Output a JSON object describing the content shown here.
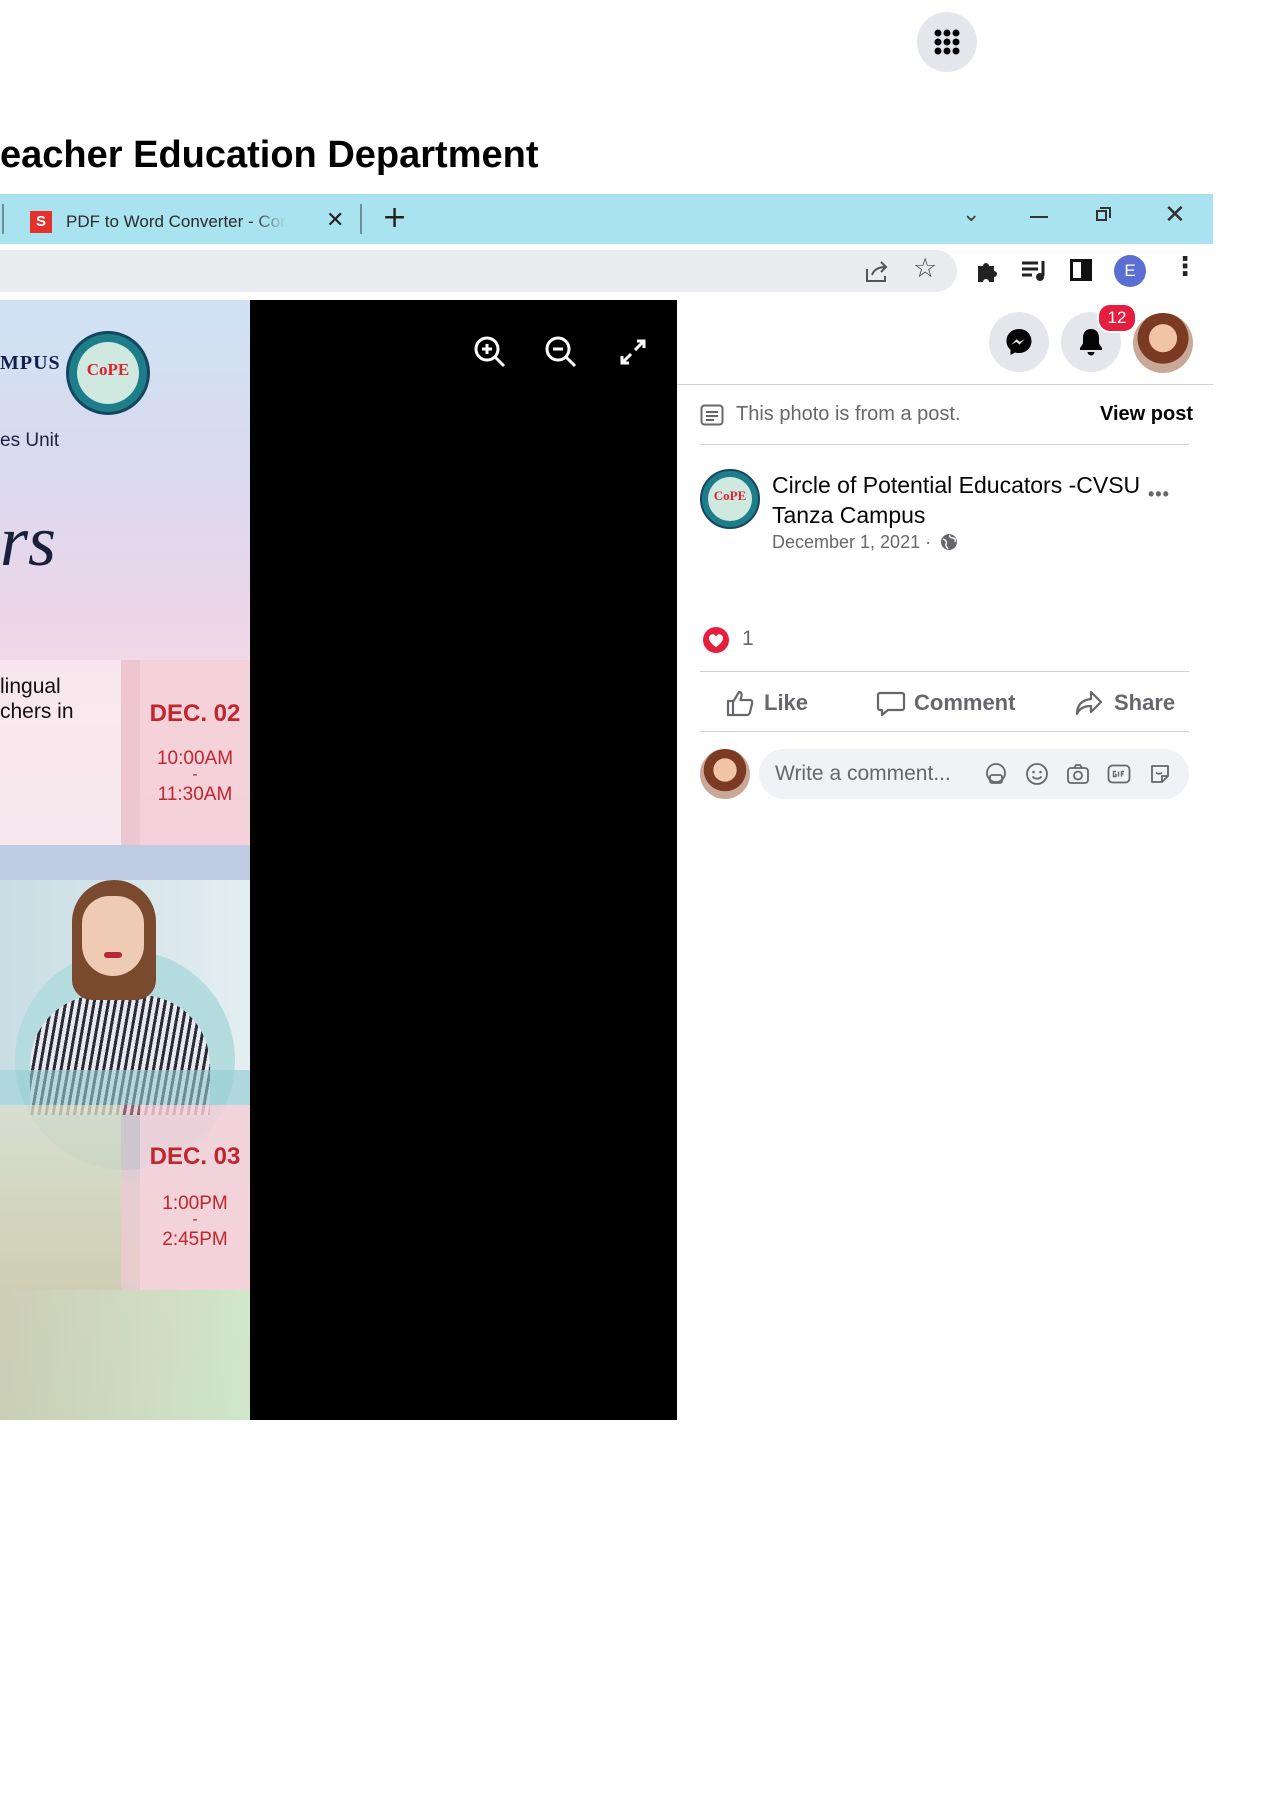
{
  "doc": {
    "heading": "eacher Education Department"
  },
  "browser": {
    "tab_title": "PDF to Word Converter - Convert",
    "tab_favicon_letter": "S",
    "profile_letter": "E"
  },
  "poster": {
    "campus_fragment": "MPUS",
    "unit_fragment": "es Unit",
    "script_fragment": "rs",
    "session1": {
      "text1": "lingual",
      "text2": "chers in",
      "date": "DEC. 02",
      "start": "10:00AM",
      "dash": "-",
      "end": "11:30AM"
    },
    "session2": {
      "date": "DEC. 03",
      "start": "1:00PM",
      "dash": "-",
      "end": "2:45PM"
    },
    "logo_text": "CoPE"
  },
  "facebook": {
    "notification_count": "12",
    "photo_note": "This photo is from a post.",
    "view_post": "View post",
    "page_name": "Circle of Potential Educators -CVSU Tanza Campus",
    "post_date": "December 1, 2021 ·",
    "more": "•••",
    "reaction_count": "1",
    "like": "Like",
    "comment": "Comment",
    "share": "Share",
    "comment_placeholder": "Write a comment..."
  },
  "colors": {
    "tabbar": "#a8e3ef",
    "reaction_heart": "#e41e3f",
    "poster_red": "#c0262e"
  }
}
